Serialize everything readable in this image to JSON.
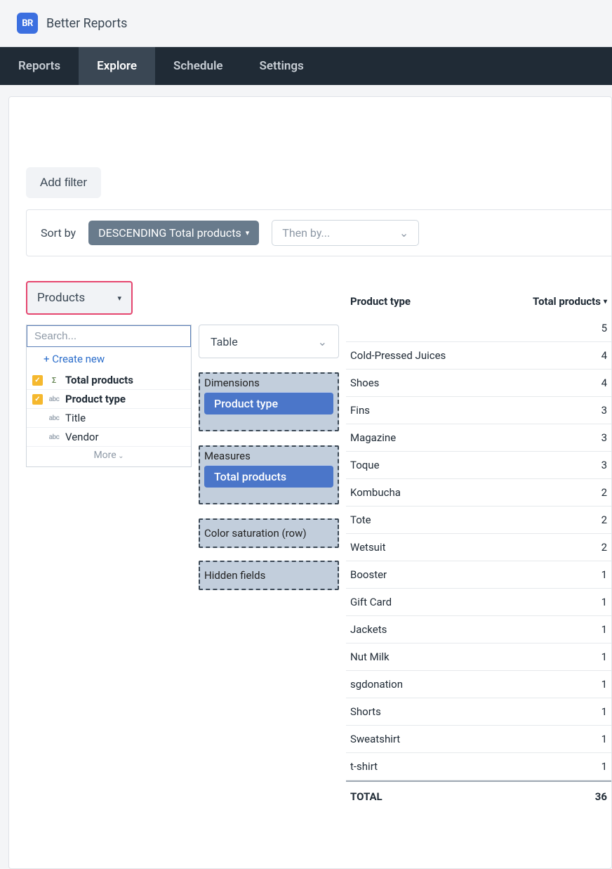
{
  "brand": {
    "logo_text": "BR",
    "name": "Better Reports"
  },
  "nav": {
    "items": [
      "Reports",
      "Explore",
      "Schedule",
      "Settings"
    ],
    "active_index": 1
  },
  "filters": {
    "add_label": "Add filter"
  },
  "sort": {
    "label": "Sort by",
    "primary": "DESCENDING Total products",
    "then_placeholder": "Then by..."
  },
  "source_select": {
    "label": "Products"
  },
  "viz_select": {
    "label": "Table"
  },
  "field_panel": {
    "search_placeholder": "Search...",
    "create_label": "+ Create new",
    "fields": [
      {
        "checked": true,
        "type": "sigma",
        "label": "Total products"
      },
      {
        "checked": true,
        "type": "abc",
        "label": "Product type"
      },
      {
        "checked": false,
        "type": "abc",
        "label": "Title"
      },
      {
        "checked": false,
        "type": "abc",
        "label": "Vendor"
      }
    ],
    "more_label": "More"
  },
  "zones": {
    "dimensions": {
      "title": "Dimensions",
      "pill": "Product type"
    },
    "measures": {
      "title": "Measures",
      "pill": "Total products"
    },
    "color": {
      "title": "Color saturation (row)"
    },
    "hidden": {
      "title": "Hidden fields"
    }
  },
  "table": {
    "columns": {
      "type": "Product type",
      "total": "Total products"
    },
    "rows": [
      {
        "type": "",
        "total": "5"
      },
      {
        "type": "Cold-Pressed Juices",
        "total": "4"
      },
      {
        "type": "Shoes",
        "total": "4"
      },
      {
        "type": "Fins",
        "total": "3"
      },
      {
        "type": "Magazine",
        "total": "3"
      },
      {
        "type": "Toque",
        "total": "3"
      },
      {
        "type": "Kombucha",
        "total": "2"
      },
      {
        "type": "Tote",
        "total": "2"
      },
      {
        "type": "Wetsuit",
        "total": "2"
      },
      {
        "type": "Booster",
        "total": "1"
      },
      {
        "type": "Gift Card",
        "total": "1"
      },
      {
        "type": "Jackets",
        "total": "1"
      },
      {
        "type": "Nut Milk",
        "total": "1"
      },
      {
        "type": "sgdonation",
        "total": "1"
      },
      {
        "type": "Shorts",
        "total": "1"
      },
      {
        "type": "Sweatshirt",
        "total": "1"
      },
      {
        "type": "t-shirt",
        "total": "1"
      }
    ],
    "footer": {
      "label": "TOTAL",
      "value": "36"
    }
  }
}
